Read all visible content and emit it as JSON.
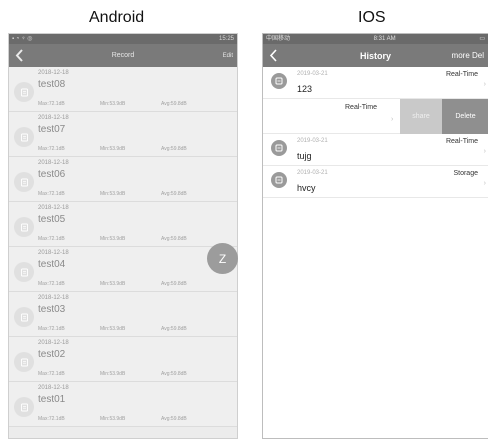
{
  "headings": {
    "android": "Android",
    "ios": "IOS"
  },
  "android": {
    "status_right": "15:25",
    "title": "Record",
    "edit_label": "Edit",
    "fab_label": "Z",
    "records": [
      {
        "date": "2018-12-18",
        "name": "test08",
        "max": "Max:72.1dB",
        "min": "Min:53.9dB",
        "avg": "Avg:59.8dB"
      },
      {
        "date": "2018-12-18",
        "name": "test07",
        "max": "Max:72.1dB",
        "min": "Min:53.9dB",
        "avg": "Avg:59.8dB"
      },
      {
        "date": "2018-12-18",
        "name": "test06",
        "max": "Max:72.1dB",
        "min": "Min:53.9dB",
        "avg": "Avg:59.8dB"
      },
      {
        "date": "2018-12-18",
        "name": "test05",
        "max": "Max:72.1dB",
        "min": "Min:53.9dB",
        "avg": "Avg:59.8dB"
      },
      {
        "date": "2018-12-18",
        "name": "test04",
        "max": "Max:72.1dB",
        "min": "Min:53.9dB",
        "avg": "Avg:59.8dB"
      },
      {
        "date": "2018-12-18",
        "name": "test03",
        "max": "Max:72.1dB",
        "min": "Min:53.9dB",
        "avg": "Avg:59.8dB"
      },
      {
        "date": "2018-12-18",
        "name": "test02",
        "max": "Max:72.1dB",
        "min": "Min:53.9dB",
        "avg": "Avg:59.8dB"
      },
      {
        "date": "2018-12-18",
        "name": "test01",
        "max": "Max:72.1dB",
        "min": "Min:53.9dB",
        "avg": "Avg:59.8dB"
      }
    ]
  },
  "ios": {
    "status_left": "中国移动",
    "status_time": "8:31 AM",
    "title": "History",
    "more_label": "more Del",
    "share_label": "share",
    "delete_label": "Delete",
    "swiped_type": "Real-Time",
    "records": [
      {
        "date": "2019-03-21",
        "name": "123",
        "type": "Real-Time"
      },
      {
        "date": "2019-03-21",
        "name": "tujg",
        "type": "Real-Time"
      },
      {
        "date": "2019-03-21",
        "name": "hvcy",
        "type": "Storage"
      }
    ]
  }
}
